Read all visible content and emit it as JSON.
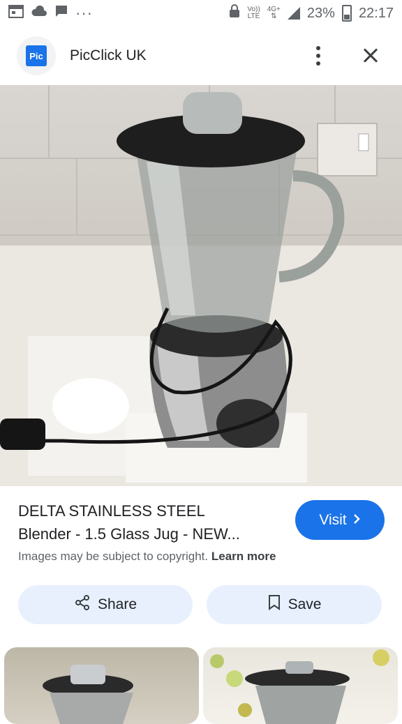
{
  "status_bar": {
    "battery": "23%",
    "time": "22:17",
    "network_top": "Vo))",
    "network_bottom": "LTE",
    "network_4g": "4G+",
    "dots": "···"
  },
  "header": {
    "favicon_text": "Pic",
    "site_name": "PicClick UK",
    "more_icon": "more-vert-icon",
    "close_icon": "close-icon"
  },
  "result": {
    "title_line1": "DELTA STAINLESS STEEL",
    "title_line2": "Blender - 1.5 Glass Jug - NEW...",
    "visit_label": "Visit",
    "copyright_text": "Images may be subject to copyright.",
    "learn_more": "Learn more",
    "share_label": "Share",
    "save_label": "Save"
  },
  "colors": {
    "accent": "#1a73e8",
    "pill_bg": "#e8f0fe"
  }
}
